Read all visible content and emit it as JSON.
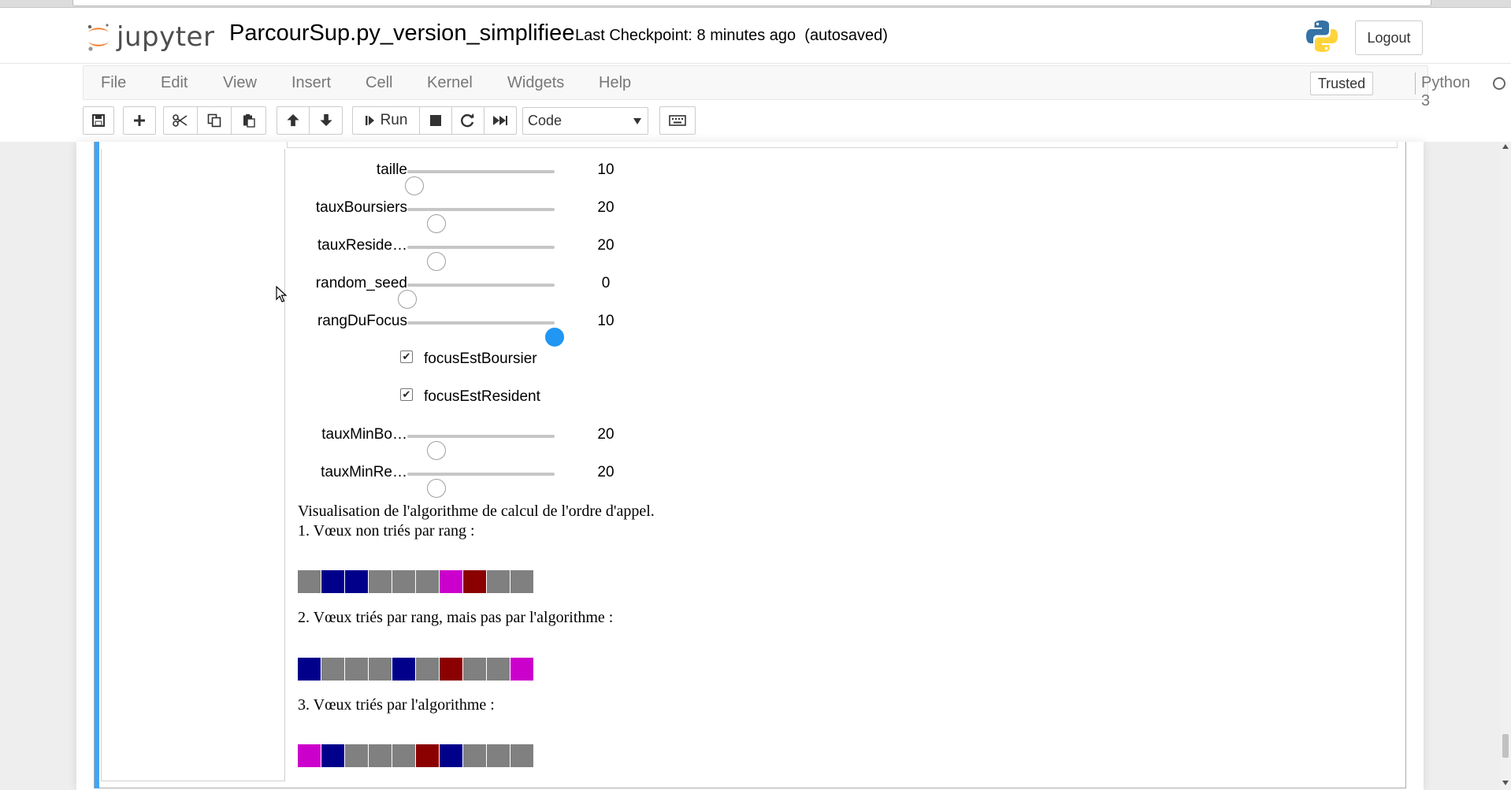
{
  "header": {
    "logo_text": "jupyter",
    "notebook_title": "ParcourSup.py_version_simplifiee",
    "checkpoint": "Last Checkpoint: 8 minutes ago",
    "autosave_status": "(autosaved)",
    "logout_label": "Logout"
  },
  "menubar": {
    "items": [
      "File",
      "Edit",
      "View",
      "Insert",
      "Cell",
      "Kernel",
      "Widgets",
      "Help"
    ],
    "trusted_label": "Trusted",
    "kernel_name": "Python 3",
    "kernel_status": "idle"
  },
  "toolbar": {
    "buttons": [
      "save-icon",
      "add-cell-icon",
      "cut-icon",
      "copy-icon",
      "paste-icon",
      "move-up-icon",
      "move-down-icon",
      "run",
      "stop-icon",
      "restart-icon",
      "fast-forward-icon"
    ],
    "run_label": "Run",
    "cell_type": "Code",
    "keyboard_icon": "keyboard-icon"
  },
  "widgets": {
    "taille": {
      "label": "taille",
      "value": "10",
      "fraction": 0.05
    },
    "tauxBoursiers": {
      "label": "tauxBoursiers",
      "value": "20",
      "fraction": 0.2
    },
    "tauxResidents": {
      "label": "tauxReside…",
      "value": "20",
      "fraction": 0.2
    },
    "random_seed": {
      "label": "random_seed",
      "value": "0",
      "fraction": 0.0
    },
    "rangDuFocus": {
      "label": "rangDuFocus",
      "value": "10",
      "fraction": 1.0
    },
    "focusEstBoursier": {
      "label": "focusEstBoursier",
      "checked": true
    },
    "focusEstResident": {
      "label": "focusEstResident",
      "checked": true
    },
    "tauxMinBoursiers": {
      "label": "tauxMinBo…",
      "value": "20",
      "fraction": 0.2
    },
    "tauxMinResidents": {
      "label": "tauxMinRe…",
      "value": "20",
      "fraction": 0.2
    }
  },
  "visualization": {
    "title": "Visualisation de l'algorithme de calcul de l'ordre d'appel.",
    "step1_label": "1. Vœux non triés par rang :",
    "step1_colors": [
      "#808080",
      "#00008b",
      "#00008b",
      "#808080",
      "#808080",
      "#808080",
      "#cc00cc",
      "#8b0000",
      "#808080",
      "#808080"
    ],
    "step2_label": "2. Vœux triés par rang, mais pas par l'algorithme :",
    "step2_colors": [
      "#00008b",
      "#808080",
      "#808080",
      "#808080",
      "#00008b",
      "#808080",
      "#8b0000",
      "#808080",
      "#808080",
      "#cc00cc"
    ],
    "step3_label": "3. Vœux triés par l'algorithme :",
    "step3_colors": [
      "#cc00cc",
      "#00008b",
      "#808080",
      "#808080",
      "#808080",
      "#8b0000",
      "#00008b",
      "#808080",
      "#808080",
      "#808080"
    ]
  },
  "colors": {
    "cell_selected_bar": "#42a5f5",
    "slider_active": "#2196f3",
    "jupyter_orange": "#f37726"
  }
}
